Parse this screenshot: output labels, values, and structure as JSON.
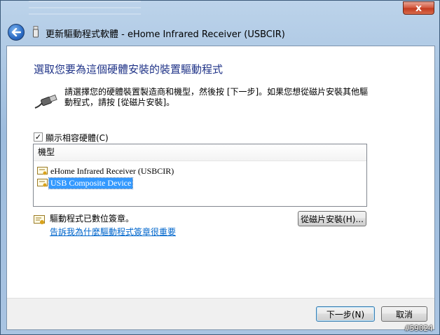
{
  "window": {
    "title": "更新驅動程式軟體 - eHome Infrared Receiver (USBCIR)",
    "close_glyph": "x"
  },
  "content": {
    "heading": "選取您要為這個硬體安裝的裝置驅動程式",
    "instruction": "請選擇您的硬體裝置製造商和機型，然後按 [下一步]。如果您想從磁片安裝其他驅動程式，請按 [從磁片安裝]。",
    "show_compatible": {
      "label": "顯示相容硬體(C)",
      "checked": true
    },
    "list": {
      "header": "機型",
      "items": [
        {
          "label": "eHome Infrared Receiver (USBCIR)",
          "selected": false
        },
        {
          "label": "USB Composite Device",
          "selected": true
        }
      ]
    },
    "signed_text": "驅動程式已數位簽章。",
    "why_link": "告訴我為什麼驅動程式簽章很重要",
    "have_disk_button": "從磁片安裝(H)..."
  },
  "footer": {
    "next_button": "下一步(N)",
    "cancel_button": "取消"
  },
  "watermark": "#59024",
  "colors": {
    "heading": "#1e3287",
    "link": "#0066cc",
    "selection": "#3399ff",
    "close_button": "#c23a1e"
  }
}
